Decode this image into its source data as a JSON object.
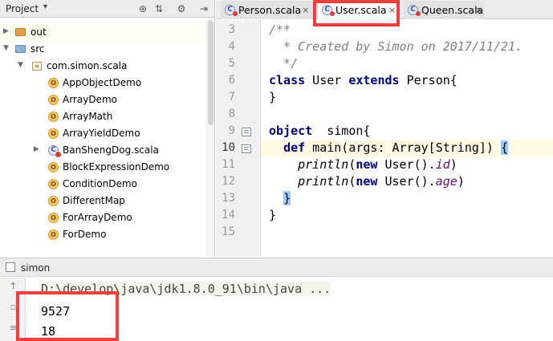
{
  "project_panel": {
    "title": "Project",
    "header_icons": [
      "target-icon",
      "collapse-icon",
      "gear-icon",
      "hide-icon"
    ],
    "tree": [
      {
        "label": "out",
        "kind": "folder-orange",
        "depth": 0,
        "expandable": true,
        "selected": true
      },
      {
        "label": "src",
        "kind": "folder-blue",
        "depth": 0,
        "expanded": true
      },
      {
        "label": "com.simon.scala",
        "kind": "package",
        "depth": 1,
        "expanded": true
      },
      {
        "label": "AppObjectDemo",
        "kind": "object",
        "depth": 2
      },
      {
        "label": "ArrayDemo",
        "kind": "object",
        "depth": 2
      },
      {
        "label": "ArrayMath",
        "kind": "object",
        "depth": 2
      },
      {
        "label": "ArrayYieldDemo",
        "kind": "object",
        "depth": 2
      },
      {
        "label": "BanShengDog.scala",
        "kind": "scala-file",
        "depth": 2,
        "expandable": true
      },
      {
        "label": "BlockExpressionDemo",
        "kind": "object",
        "depth": 2
      },
      {
        "label": "ConditionDemo",
        "kind": "object",
        "depth": 2
      },
      {
        "label": "DifferentMap",
        "kind": "object",
        "depth": 2
      },
      {
        "label": "ForArrayDemo",
        "kind": "object",
        "depth": 2
      },
      {
        "label": "ForDemo",
        "kind": "object",
        "depth": 2
      }
    ]
  },
  "tabs": [
    {
      "label": "Person.scala",
      "close": "×"
    },
    {
      "label": "User.scala",
      "close": "×",
      "active": true
    },
    {
      "label": "Queen.scala",
      "close": "×"
    }
  ],
  "editor": {
    "line_numbers": [
      "3",
      "4",
      "5",
      "6",
      "7",
      "8",
      "9",
      "10",
      "11",
      "12",
      "13",
      "14",
      "15"
    ],
    "current_line": "10",
    "lines": {
      "l3": "/**",
      "l4": "  * Created by Simon on 2017/11/21.",
      "l5": "  */",
      "l6_kw1": "class",
      "l6_a": " User ",
      "l6_kw2": "extends",
      "l6_b": " Person{",
      "l7": "}",
      "l9_kw": "object",
      "l9_a": "  simon{",
      "l10_kw": "def",
      "l10_a": " main(args: Array[String]) ",
      "l10_brace": "{",
      "l11_fn": "println",
      "l11_p": "(",
      "l11_kw": "new",
      "l11_a": " User().",
      "l11_fld": "id",
      "l11_b": ")",
      "l12_fn": "println",
      "l12_p": "(",
      "l12_kw": "new",
      "l12_a": " User().",
      "l12_fld": "age",
      "l12_b": ")",
      "l13_brace": "}",
      "l14": "}"
    }
  },
  "run": {
    "tab_label": "simon",
    "command": "D:\\develop\\java\\jdk1.8.0_91\\bin\\java ...",
    "output": [
      "9527",
      "18"
    ]
  },
  "colors": {
    "keyword": "#000080",
    "comment": "#808080",
    "field": "#660e7a",
    "annotation_red": "#f43d3d",
    "brace_highlight": "#99ccff"
  }
}
